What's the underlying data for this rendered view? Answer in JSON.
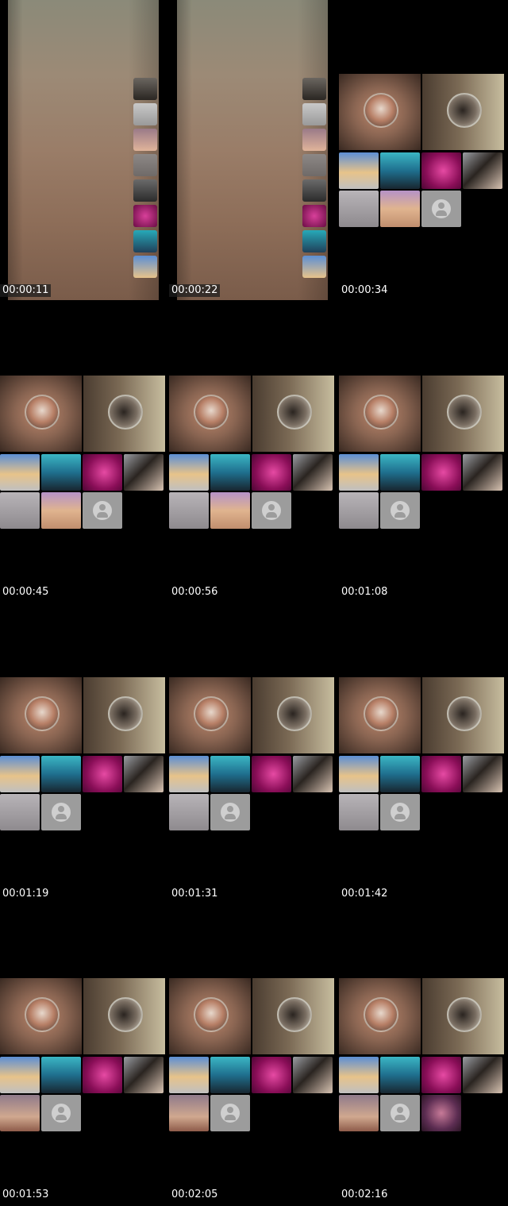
{
  "frames": [
    {
      "time": "00:00:11",
      "layout": "single",
      "strip": [
        "gray",
        "gray2",
        "girl",
        "gray3",
        "dark",
        "pink",
        "teal",
        "blue"
      ]
    },
    {
      "time": "00:00:22",
      "layout": "single",
      "strip": [
        "gray",
        "gray2",
        "girl",
        "gray3",
        "dark",
        "pink",
        "teal",
        "blue"
      ]
    },
    {
      "time": "00:00:34",
      "layout": "grid",
      "row2": [
        "c0",
        "c1",
        "c2",
        "c3"
      ],
      "row3": [
        "c4",
        "c5",
        "avatar"
      ]
    },
    {
      "time": "00:00:45",
      "layout": "grid",
      "row2": [
        "c0",
        "c1",
        "c2",
        "c3"
      ],
      "row3": [
        "c4",
        "c5",
        "avatar"
      ]
    },
    {
      "time": "00:00:56",
      "layout": "grid",
      "row2": [
        "c0",
        "c1",
        "c2",
        "c3"
      ],
      "row3": [
        "c4",
        "c5",
        "avatar"
      ]
    },
    {
      "time": "00:01:08",
      "layout": "grid",
      "row2": [
        "c0",
        "c1",
        "c2",
        "c3"
      ],
      "row3": [
        "c4",
        "avatar"
      ]
    },
    {
      "time": "00:01:19",
      "layout": "grid",
      "row2": [
        "c0",
        "c1",
        "c2",
        "c3"
      ],
      "row3": [
        "c4",
        "avatar"
      ]
    },
    {
      "time": "00:01:31",
      "layout": "grid",
      "row2": [
        "c0",
        "c1",
        "c2",
        "c3"
      ],
      "row3": [
        "c4",
        "avatar"
      ]
    },
    {
      "time": "00:01:42",
      "layout": "grid",
      "row2": [
        "c0",
        "c1",
        "c2",
        "c3"
      ],
      "row3": [
        "c4",
        "avatar"
      ]
    },
    {
      "time": "00:01:53",
      "layout": "grid",
      "row2": [
        "c0",
        "c1",
        "c2",
        "c3"
      ],
      "row3": [
        "c7",
        "avatar"
      ]
    },
    {
      "time": "00:02:05",
      "layout": "grid",
      "row2": [
        "c0",
        "c1",
        "c2",
        "c3"
      ],
      "row3": [
        "c7",
        "avatar"
      ]
    },
    {
      "time": "00:02:16",
      "layout": "grid",
      "row2": [
        "c0",
        "c1",
        "c2",
        "c3"
      ],
      "row3": [
        "c7",
        "avatar",
        "c6"
      ]
    }
  ]
}
